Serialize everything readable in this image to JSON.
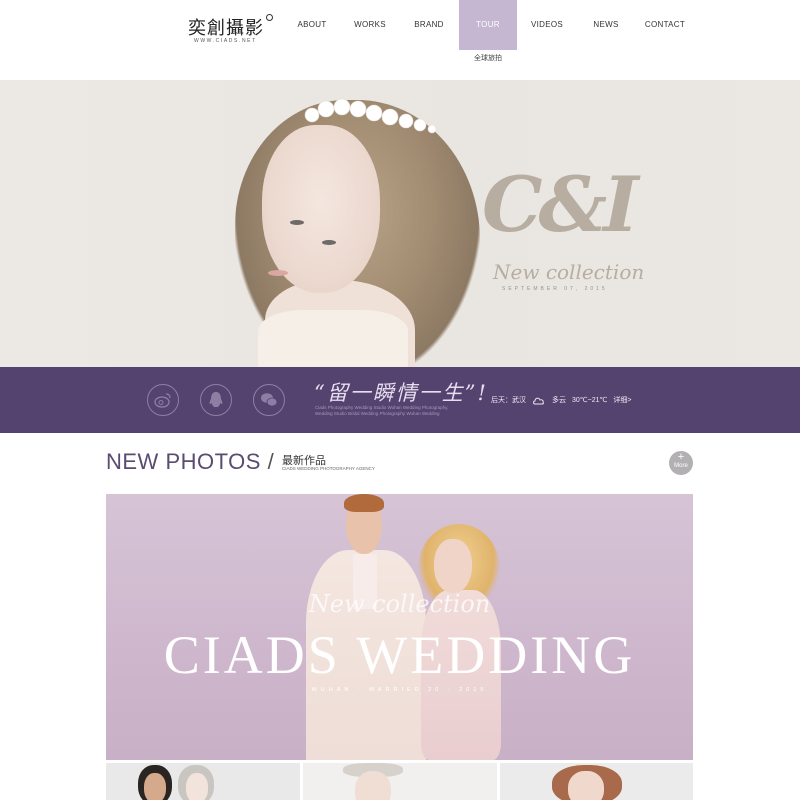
{
  "header": {
    "logo_text": "奕創攝影",
    "logo_sub": "WWW.CIADS.NET",
    "nav": [
      {
        "label": "ABOUT"
      },
      {
        "label": "WORKS"
      },
      {
        "label": "BRAND"
      },
      {
        "label": "TOUR",
        "active": true
      },
      {
        "label": "VIDEOS"
      },
      {
        "label": "NEWS"
      },
      {
        "label": "CONTACT"
      }
    ],
    "tour_sub": "全球旅拍"
  },
  "hero": {
    "brand": "C&I",
    "collection": "New collection",
    "date": "SEPTEMBER 07, 2015"
  },
  "info_bar": {
    "social": [
      {
        "icon": "weibo-icon"
      },
      {
        "icon": "qq-icon"
      },
      {
        "icon": "wechat-icon"
      }
    ],
    "slogan": "“留一瞬情一生”!",
    "slogan_sub": "Ciads Photography Wedding Studio Wuhan Wedding Photography, Wedding Studio Bridal Wedding Photography Wuhan Wedding",
    "weather": {
      "today": "后天：武汉",
      "condition": "多云",
      "temp": "30℃~21℃",
      "details": "详细>"
    },
    "color": "#54436f"
  },
  "new_photos": {
    "title": "NEW PHOTOS",
    "slash": "/",
    "title_cn": "最新作品",
    "subtitle": "CIADS WEDDING PHOTOGRAPHY AGENCY",
    "more_plus": "+",
    "more_label": "More"
  },
  "banner": {
    "script": "New collection",
    "title": "CIADS WEDDING",
    "subtitle": "WUHAN · MARRIED 20 · 2015"
  }
}
